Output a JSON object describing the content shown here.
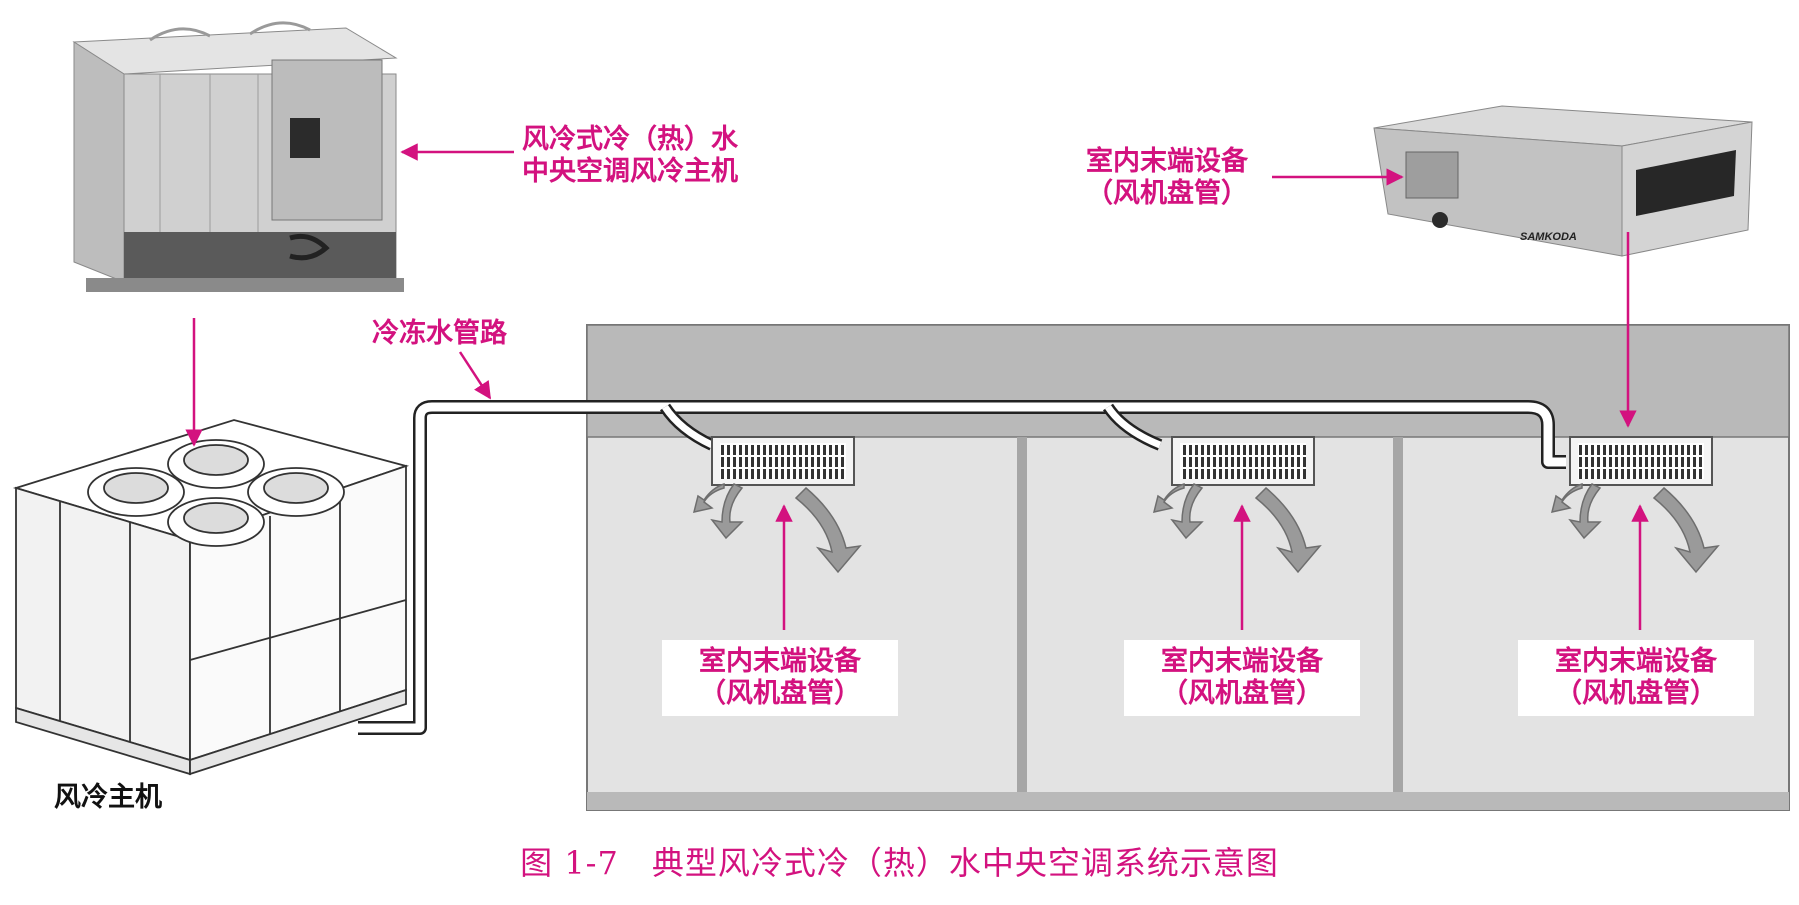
{
  "labels": {
    "chiller_main": [
      "风冷式冷（热）水",
      "中央空调风冷主机"
    ],
    "indoor_top": [
      "室内末端设备",
      "（风机盘管）"
    ],
    "pipe": "冷冻水管路",
    "outdoor_unit": "风冷主机",
    "room_units": [
      [
        "室内末端设备",
        "（风机盘管）"
      ],
      [
        "室内末端设备",
        "（风机盘管）"
      ],
      [
        "室内末端设备",
        "（风机盘管）"
      ]
    ]
  },
  "caption": "图 1-7　典型风冷式冷（热）水中央空调系统示意图",
  "fan_coil_brand": "SAMKODA",
  "colors": {
    "accent": "#d3127f",
    "ceiling": "#b9b9b9",
    "room": "#e3e3e3",
    "equipment": "#c8c8c8"
  }
}
